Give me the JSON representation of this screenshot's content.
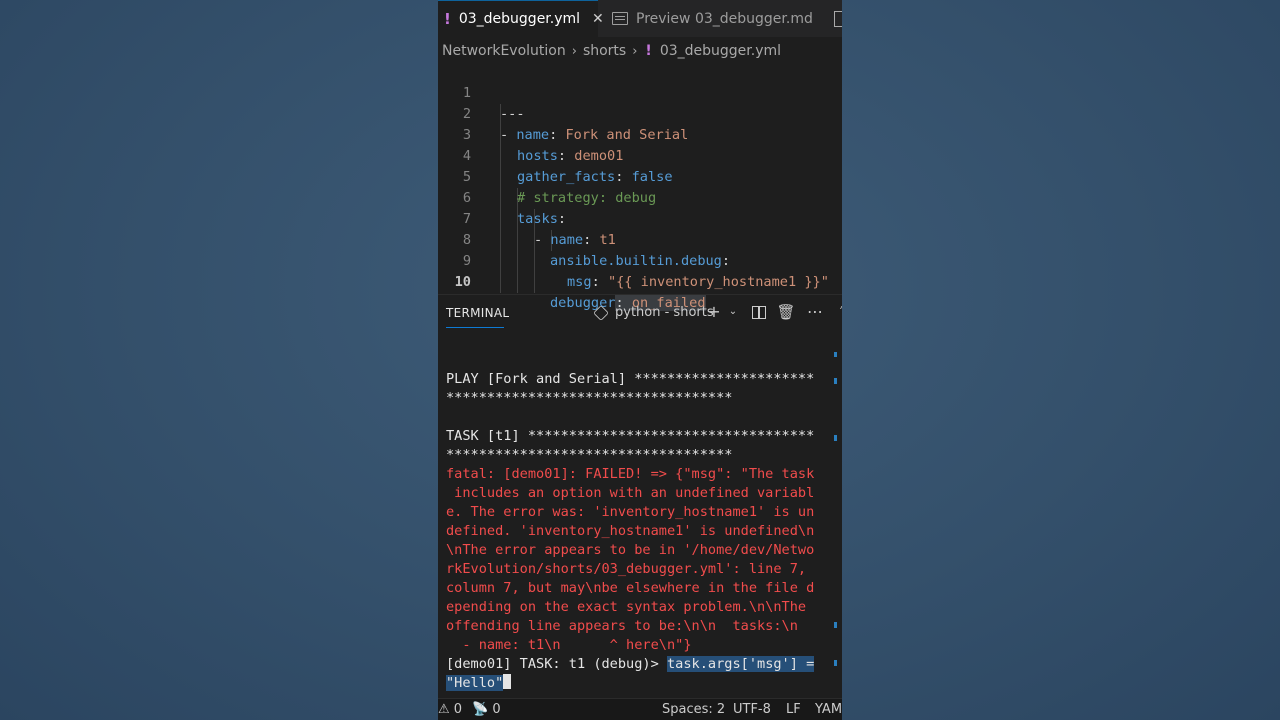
{
  "tabs": [
    {
      "label": "03_debugger.yml",
      "icon": "yaml-file-icon",
      "active": true
    },
    {
      "label": "Preview 03_debugger.md",
      "icon": "preview-icon",
      "active": false
    }
  ],
  "breadcrumb": [
    "NetworkEvolution",
    "shorts",
    "03_debugger.yml"
  ],
  "editor": {
    "line_numbers": [
      "1",
      "2",
      "3",
      "4",
      "5",
      "6",
      "7",
      "8",
      "9",
      "10"
    ],
    "lines": [
      [
        "---"
      ],
      [
        "- ",
        "name",
        ": ",
        "Fork and Serial"
      ],
      [
        "hosts",
        ": ",
        "demo01"
      ],
      [
        "gather_facts",
        ": ",
        "false"
      ],
      [
        "# strategy: debug"
      ],
      [
        "tasks",
        ":"
      ],
      [
        "- ",
        "name",
        ": ",
        "t1"
      ],
      [
        "ansible.builtin.debug",
        ":"
      ],
      [
        "msg",
        ": ",
        "\"{{ inventory_hostname1 }}\""
      ],
      [
        "debugger",
        ": ",
        "on_failed"
      ]
    ]
  },
  "terminal": {
    "title": "TERMINAL",
    "profile": "python - shorts",
    "lines": [
      "PLAY [Fork and Serial] **********************",
      "***********************************",
      "",
      "TASK [t1] ***********************************",
      "***********************************",
      "fatal: [demo01]: FAILED! => {\"msg\": \"The task",
      " includes an option with an undefined variabl",
      "e. The error was: 'inventory_hostname1' is un",
      "defined. 'inventory_hostname1' is undefined\\n",
      "\\nThe error appears to be in '/home/dev/Netwo",
      "rkEvolution/shorts/03_debugger.yml': line 7,",
      "column 7, but may\\nbe elsewhere in the file d",
      "epending on the exact syntax problem.\\n\\nThe",
      "offending line appears to be:\\n\\n  tasks:\\n",
      "  - name: t1\\n      ^ here\\n\"}"
    ],
    "prompt": "[demo01] TASK: t1 (debug)> ",
    "command_line1": "task.args['msg'] =",
    "command_line2": "\"Hello\""
  },
  "statusbar": {
    "warnings": "0",
    "ports": "0",
    "spaces": "Spaces: 2",
    "encoding": "UTF-8",
    "eol": "LF",
    "language": "YAM"
  },
  "colors": {
    "background": "#34506b",
    "editor_bg": "#1e1e1e",
    "key": "#569cd6",
    "string": "#ce9178",
    "comment": "#6a9955",
    "error": "#f14c4c",
    "selection": "#264f78"
  }
}
